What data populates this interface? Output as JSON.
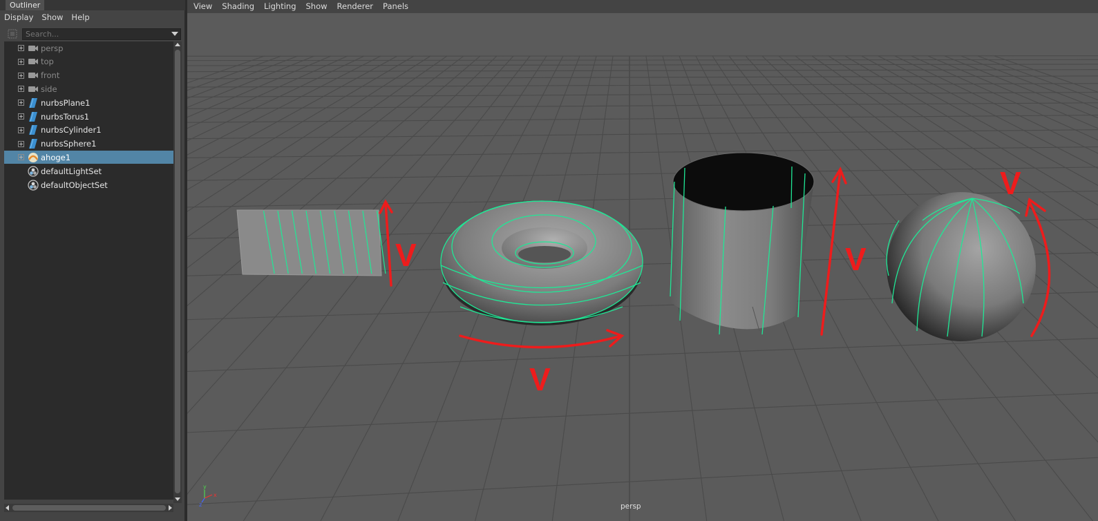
{
  "outliner": {
    "tab_title": "Outliner",
    "menu": [
      "Display",
      "Show",
      "Help"
    ],
    "search_placeholder": "Search...",
    "items": [
      {
        "label": "persp",
        "type": "camera",
        "dimmed": true,
        "expandable": true,
        "selected": false
      },
      {
        "label": "top",
        "type": "camera",
        "dimmed": true,
        "expandable": true,
        "selected": false
      },
      {
        "label": "front",
        "type": "camera",
        "dimmed": true,
        "expandable": true,
        "selected": false
      },
      {
        "label": "side",
        "type": "camera",
        "dimmed": true,
        "expandable": true,
        "selected": false
      },
      {
        "label": "nurbsPlane1",
        "type": "nurbs",
        "dimmed": false,
        "expandable": true,
        "selected": false
      },
      {
        "label": "nurbsTorus1",
        "type": "nurbs",
        "dimmed": false,
        "expandable": true,
        "selected": false
      },
      {
        "label": "nurbsCylinder1",
        "type": "nurbs",
        "dimmed": false,
        "expandable": true,
        "selected": false
      },
      {
        "label": "nurbsSphere1",
        "type": "nurbs",
        "dimmed": false,
        "expandable": true,
        "selected": false
      },
      {
        "label": "ahoge1",
        "type": "hair",
        "dimmed": false,
        "expandable": true,
        "selected": true
      },
      {
        "label": "defaultLightSet",
        "type": "set",
        "dimmed": false,
        "expandable": false,
        "selected": false
      },
      {
        "label": "defaultObjectSet",
        "type": "set",
        "dimmed": false,
        "expandable": false,
        "selected": false
      }
    ]
  },
  "viewport": {
    "menu": [
      "View",
      "Shading",
      "Lighting",
      "Show",
      "Renderer",
      "Panels"
    ],
    "camera_name": "persp",
    "annotation_letter": "V",
    "axis_labels": {
      "x": "x",
      "y": "y",
      "z": "z"
    }
  },
  "colors": {
    "panel_bg": "#444444",
    "tree_bg": "#2b2b2b",
    "selection": "#5285a6",
    "viewport_bg": "#5b5b5b",
    "grid": "#4a4a4a",
    "isoparm": "#1fe896",
    "annotation": "#ee1c1c"
  },
  "icons": {
    "camera": "camera-icon",
    "nurbs": "nurbs-surface-icon",
    "hair": "hair-system-icon",
    "set": "object-set-icon",
    "filter": "filter-icon",
    "search_dropdown": "chevron-down-icon"
  }
}
